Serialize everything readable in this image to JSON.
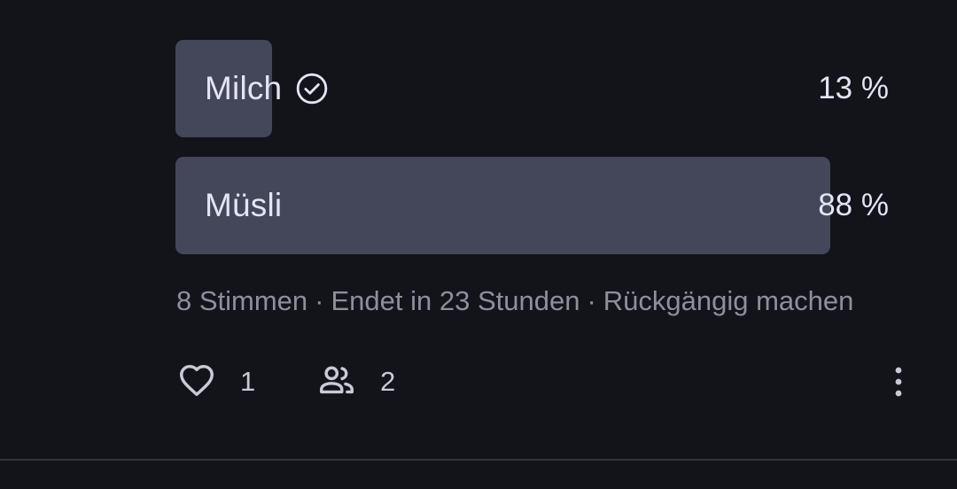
{
  "poll": {
    "options": [
      {
        "label": "Milch",
        "percent_text": "13 %",
        "share": 0.13,
        "voted": true
      },
      {
        "label": "Müsli",
        "percent_text": "88 %",
        "share": 0.88,
        "voted": false
      }
    ],
    "votes": "8 Stimmen",
    "separator": "·",
    "ends": "Endet in 23 Stunden",
    "undo": "Rückgängig machen"
  },
  "actions": {
    "likes": "1",
    "participants": "2"
  },
  "colors": {
    "background": "#13131a",
    "bar": "#444759",
    "text": "#e3e4f4",
    "muted": "#8e8f9d",
    "divider": "#34343f"
  },
  "icons": [
    "check-circle-icon",
    "heart-icon",
    "people-icon",
    "more-vertical-icon"
  ]
}
